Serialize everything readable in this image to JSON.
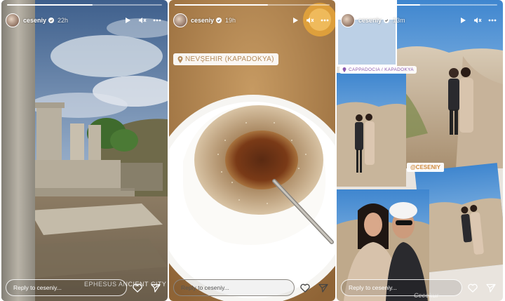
{
  "stories": [
    {
      "username": "ceseniy",
      "time": "22h",
      "progress": 0.55,
      "reply_placeholder": "Reply to ceseniy...",
      "photo_text": "EPHESUS ANCIENT CITY"
    },
    {
      "username": "ceseniy",
      "time": "19h",
      "progress": 0.6,
      "reply_placeholder": "Reply to ceseniy...",
      "location": "NEVŞEHIR (KAPADOKYA)"
    },
    {
      "username": "ceseniy",
      "time": "13m",
      "progress": 0.5,
      "reply_placeholder": "Reply to ceseniy...",
      "location": "CAPPADOCIA / KAPADOKYA",
      "mention": "@CESENIY",
      "watermark": "Cecekur"
    }
  ],
  "colors": {
    "accent_mention": "#d08a3c",
    "accent_location": "#8a5ab0"
  }
}
